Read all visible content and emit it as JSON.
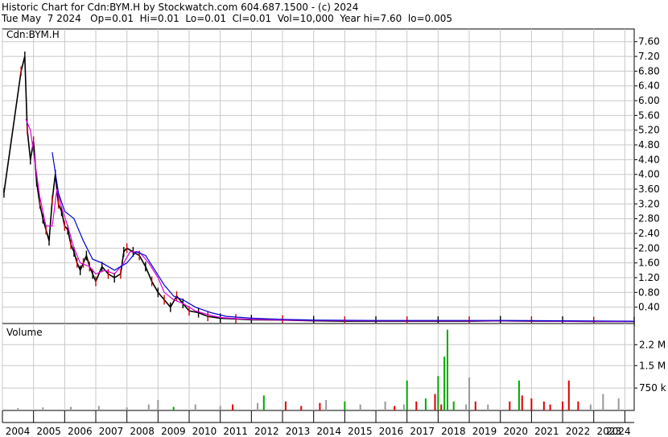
{
  "header": {
    "line1": "Historic Chart for Cdn:BYM.H by Stockwatch.com 604.687.1500 - (c) 2024",
    "line2": "Tue May  7 2024   Op=0.01  Hi=0.01  Lo=0.01  Cl=0.01  Vol=10,000  Year hi=7.60  lo=0.005"
  },
  "price_panel": {
    "symbol_label": "Cdn:BYM.H"
  },
  "volume_panel": {
    "label": "Volume"
  },
  "colors": {
    "price_up": "#cc0000",
    "price_down": "#000000",
    "ma_short": "#dd00dd",
    "ma_long": "#0000cc",
    "vol_up": "#00aa00",
    "vol_down": "#dd0000",
    "vol_flat": "#999999",
    "grid": "#c8c8c8"
  },
  "chart_data": [
    {
      "type": "line",
      "title": "Historic Chart for Cdn:BYM.H",
      "y_ticks": [
        "7.60",
        "7.20",
        "6.80",
        "6.40",
        "6.00",
        "5.60",
        "5.20",
        "4.80",
        "4.40",
        "4.00",
        "3.60",
        "3.20",
        "2.80",
        "2.40",
        "2.00",
        "1.60",
        "1.20",
        "0.80",
        "0.40"
      ],
      "x_ticks": [
        "2004",
        "2005",
        "2006",
        "2007",
        "2008",
        "2009",
        "2010",
        "2011",
        "2012",
        "2013",
        "2014",
        "2015",
        "2016",
        "2017",
        "2018",
        "2019",
        "2020",
        "2021",
        "2022",
        "2023",
        "2024"
      ],
      "ylim": [
        0,
        7.9
      ],
      "series": [
        {
          "style": "price",
          "x": [
            2004.05,
            2004.6,
            2004.72,
            2004.8,
            2004.9,
            2005.0,
            2005.1,
            2005.2,
            2005.3,
            2005.4,
            2005.5,
            2005.6,
            2005.7,
            2005.8,
            2005.9,
            2006.0,
            2006.1,
            2006.2,
            2006.3,
            2006.4,
            2006.5,
            2006.6,
            2006.7,
            2006.8,
            2006.9,
            2007.0,
            2007.2,
            2007.4,
            2007.6,
            2007.8,
            2007.9,
            2008.0,
            2008.2,
            2008.4,
            2008.6,
            2008.8,
            2009.0,
            2009.2,
            2009.4,
            2009.6,
            2009.8,
            2010.0,
            2010.3,
            2010.6,
            2011.0,
            2011.5,
            2012.0,
            2013.0,
            2014.0,
            2015.0,
            2016.0,
            2017.0,
            2018.0,
            2019.0,
            2020.0,
            2021.0,
            2022.0,
            2023.0,
            2024.3
          ],
          "y": [
            3.5,
            6.8,
            7.2,
            5.2,
            4.4,
            4.9,
            3.8,
            3.2,
            2.8,
            2.5,
            2.2,
            3.3,
            4.0,
            3.2,
            3.0,
            2.6,
            2.5,
            2.1,
            1.9,
            1.6,
            1.4,
            1.6,
            1.8,
            1.5,
            1.3,
            1.1,
            1.5,
            1.3,
            1.2,
            1.3,
            1.9,
            2.0,
            1.9,
            1.8,
            1.5,
            1.1,
            0.8,
            0.6,
            0.4,
            0.7,
            0.5,
            0.3,
            0.25,
            0.15,
            0.1,
            0.08,
            0.06,
            0.05,
            0.03,
            0.02,
            0.02,
            0.02,
            0.02,
            0.02,
            0.03,
            0.02,
            0.02,
            0.01,
            0.01
          ]
        },
        {
          "style": "ma_short",
          "x": [
            2004.75,
            2004.9,
            2005.0,
            2005.2,
            2005.4,
            2005.6,
            2005.75,
            2005.9,
            2006.1,
            2006.3,
            2006.5,
            2006.8,
            2007.0,
            2007.3,
            2007.6,
            2007.9,
            2008.1,
            2008.4,
            2008.7,
            2009.0,
            2009.2,
            2009.5,
            2009.8,
            2010.2,
            2010.6,
            2011.0,
            2011.5,
            2012.0,
            2013.0,
            2014.0,
            2016.0,
            2018.0,
            2020.0,
            2022.0,
            2024.3
          ],
          "y": [
            5.5,
            5.2,
            4.6,
            3.4,
            2.6,
            2.6,
            3.6,
            3.1,
            2.6,
            2.0,
            1.6,
            1.5,
            1.3,
            1.4,
            1.3,
            1.6,
            1.9,
            1.9,
            1.6,
            1.2,
            0.8,
            0.6,
            0.5,
            0.3,
            0.2,
            0.12,
            0.09,
            0.07,
            0.05,
            0.04,
            0.03,
            0.03,
            0.03,
            0.02,
            0.01
          ]
        },
        {
          "style": "ma_long",
          "x": [
            2005.6,
            2005.8,
            2006.0,
            2006.3,
            2006.6,
            2006.9,
            2007.2,
            2007.6,
            2008.0,
            2008.3,
            2008.6,
            2008.9,
            2009.2,
            2009.5,
            2009.8,
            2010.2,
            2010.7,
            2011.2,
            2012.0,
            2013.0,
            2014.0,
            2016.0,
            2018.0,
            2020.0,
            2022.0,
            2024.3
          ],
          "y": [
            4.6,
            3.5,
            3.0,
            2.8,
            2.2,
            1.7,
            1.6,
            1.4,
            1.6,
            1.9,
            1.8,
            1.4,
            1.0,
            0.7,
            0.6,
            0.4,
            0.25,
            0.15,
            0.1,
            0.07,
            0.05,
            0.04,
            0.04,
            0.04,
            0.03,
            0.02
          ]
        }
      ]
    },
    {
      "type": "bar",
      "title": "Volume",
      "y_ticks": [
        "2.2 M",
        "1.5 M",
        "750 k"
      ],
      "ylim": [
        0,
        2.8
      ],
      "units": "M",
      "x": [
        2004.5,
        2005.3,
        2006.2,
        2007.1,
        2008.0,
        2008.7,
        2009.0,
        2009.5,
        2010.2,
        2011.0,
        2011.4,
        2012.2,
        2012.4,
        2013.1,
        2013.6,
        2014.2,
        2014.4,
        2015.0,
        2015.5,
        2016.3,
        2016.6,
        2016.9,
        2017.0,
        2017.3,
        2017.6,
        2017.9,
        2018.0,
        2018.1,
        2018.2,
        2018.3,
        2018.5,
        2018.9,
        2019.0,
        2019.2,
        2019.6,
        2020.3,
        2020.6,
        2020.7,
        2021.0,
        2021.4,
        2021.6,
        2022.0,
        2022.2,
        2022.5,
        2022.9,
        2023.3,
        2023.8
      ],
      "values": [
        0.08,
        0.1,
        0.12,
        0.15,
        0.1,
        0.2,
        0.35,
        0.12,
        0.2,
        0.15,
        0.2,
        0.25,
        0.5,
        0.3,
        0.15,
        0.25,
        0.35,
        0.3,
        0.2,
        0.3,
        0.15,
        0.2,
        1.0,
        0.3,
        0.4,
        0.55,
        1.15,
        0.2,
        1.8,
        2.7,
        0.3,
        0.2,
        1.1,
        0.3,
        0.2,
        0.3,
        1.0,
        0.5,
        0.4,
        0.3,
        0.2,
        0.3,
        1.0,
        0.3,
        0.2,
        0.55,
        0.4
      ],
      "dir": [
        "f",
        "f",
        "f",
        "f",
        "f",
        "f",
        "f",
        "u",
        "f",
        "f",
        "d",
        "f",
        "u",
        "d",
        "d",
        "d",
        "f",
        "u",
        "f",
        "f",
        "d",
        "f",
        "u",
        "d",
        "u",
        "d",
        "u",
        "d",
        "u",
        "u",
        "u",
        "f",
        "f",
        "d",
        "f",
        "d",
        "u",
        "d",
        "d",
        "d",
        "d",
        "d",
        "d",
        "d",
        "f",
        "f",
        "f"
      ]
    }
  ]
}
